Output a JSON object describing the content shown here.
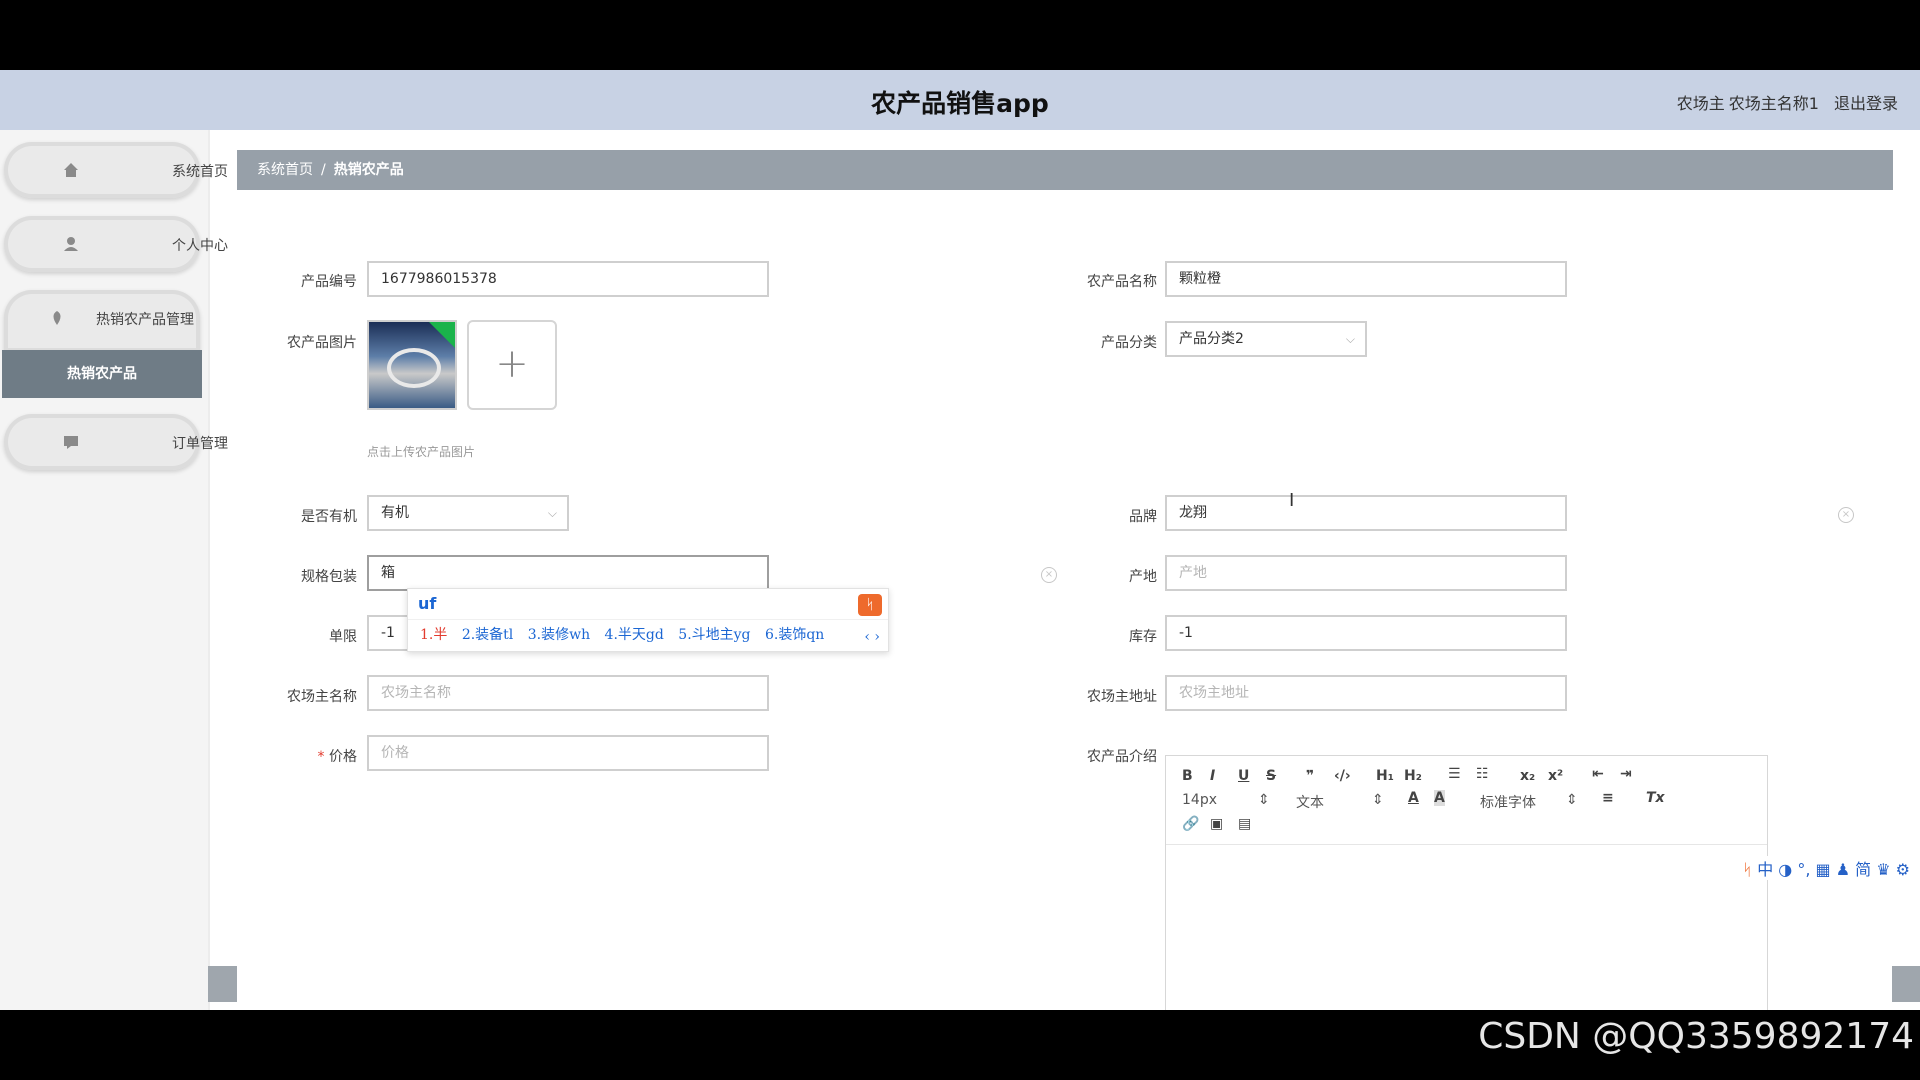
{
  "header": {
    "app_title": "农产品销售app",
    "role": "农场主",
    "username": "农场主名称1",
    "logout": "退出登录"
  },
  "sidebar": {
    "items": [
      {
        "label": "系统首页",
        "icon": "home-icon"
      },
      {
        "label": "个人中心",
        "icon": "user-icon"
      },
      {
        "label": "热销农产品管理",
        "icon": "leaf-icon"
      },
      {
        "label": "订单管理",
        "icon": "message-icon"
      }
    ],
    "active_sub": "热销农产品"
  },
  "breadcrumb": {
    "home": "系统首页",
    "sep": "/",
    "current": "热销农产品"
  },
  "form": {
    "product_no": {
      "label": "产品编号",
      "value": "1677986015378"
    },
    "product_name": {
      "label": "农产品名称",
      "value": "颗粒橙"
    },
    "image": {
      "label": "农产品图片",
      "hint": "点击上传农产品图片",
      "upload": "+"
    },
    "category": {
      "label": "产品分类",
      "value": "产品分类2"
    },
    "organic": {
      "label": "是否有机",
      "value": "有机"
    },
    "brand": {
      "label": "品牌",
      "value": "龙翔"
    },
    "spec": {
      "label": "规格包装",
      "value": "箱"
    },
    "origin": {
      "label": "产地",
      "placeholder": "产地"
    },
    "limit": {
      "label": "单限",
      "value": "-1"
    },
    "stock": {
      "label": "库存",
      "value": "-1"
    },
    "farmer_name": {
      "label": "农场主名称",
      "placeholder": "农场主名称"
    },
    "farmer_address": {
      "label": "农场主地址",
      "placeholder": "农场主地址"
    },
    "price": {
      "label": "价格",
      "required": "*",
      "placeholder": "价格"
    },
    "intro": {
      "label": "农产品介绍"
    }
  },
  "ime": {
    "input": "uf",
    "candidates": [
      "1.半",
      "2.装备tl",
      "3.装修wh",
      "4.半天gd",
      "5.斗地主yg",
      "6.装饰qn"
    ],
    "more": "‹ ›"
  },
  "editor": {
    "font_size": "14px",
    "text_type": "文本",
    "font_family": "标准字体"
  },
  "tray": {
    "text": "中 ◑ °, ▦ ♟ 简 ♛ ⚙"
  },
  "watermark": "CSDN @QQ3359892174"
}
